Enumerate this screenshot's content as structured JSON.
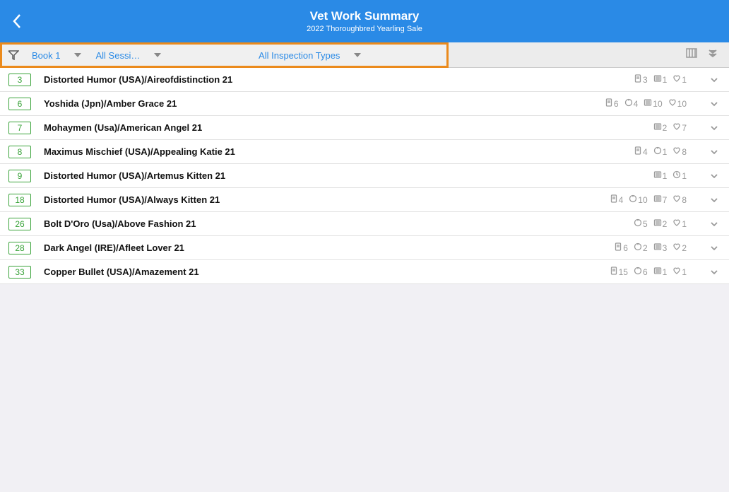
{
  "header": {
    "title": "Vet Work Summary",
    "subtitle": "2022 Thoroughbred Yearling Sale"
  },
  "filters": {
    "book": "Book 1",
    "session": "All Sessi…",
    "inspection": "All Inspection Types"
  },
  "rows": [
    {
      "lot": "3",
      "name": "Distorted Humor (USA)/Aireofdistinction 21",
      "stats": {
        "doc": "3",
        "scope": null,
        "xray": "1",
        "heart": "1"
      }
    },
    {
      "lot": "6",
      "name": "Yoshida (Jpn)/Amber Grace 21",
      "stats": {
        "doc": "6",
        "scope": "4",
        "xray": "10",
        "heart": "10"
      }
    },
    {
      "lot": "7",
      "name": "Mohaymen (Usa)/American Angel 21",
      "stats": {
        "doc": null,
        "scope": null,
        "xray": "2",
        "heart": "7"
      }
    },
    {
      "lot": "8",
      "name": "Maximus Mischief (USA)/Appealing Katie 21",
      "stats": {
        "doc": "4",
        "scope": "1",
        "xray": null,
        "heart": "8"
      }
    },
    {
      "lot": "9",
      "name": "Distorted Humor (USA)/Artemus Kitten 21",
      "stats": {
        "doc": null,
        "scope": null,
        "xray": "1",
        "heart": null,
        "clock": "1"
      }
    },
    {
      "lot": "18",
      "name": "Distorted Humor (USA)/Always Kitten 21",
      "stats": {
        "doc": "4",
        "scope": "10",
        "xray": "7",
        "heart": "8"
      }
    },
    {
      "lot": "26",
      "name": "Bolt D'Oro (Usa)/Above Fashion 21",
      "stats": {
        "doc": null,
        "scope": "5",
        "xray": "2",
        "heart": "1"
      }
    },
    {
      "lot": "28",
      "name": "Dark Angel (IRE)/Afleet Lover 21",
      "stats": {
        "doc": "6",
        "scope": "2",
        "xray": "3",
        "heart": "2"
      }
    },
    {
      "lot": "33",
      "name": "Copper Bullet (USA)/Amazement 21",
      "stats": {
        "doc": "15",
        "scope": "6",
        "xray": "1",
        "heart": "1"
      }
    }
  ]
}
